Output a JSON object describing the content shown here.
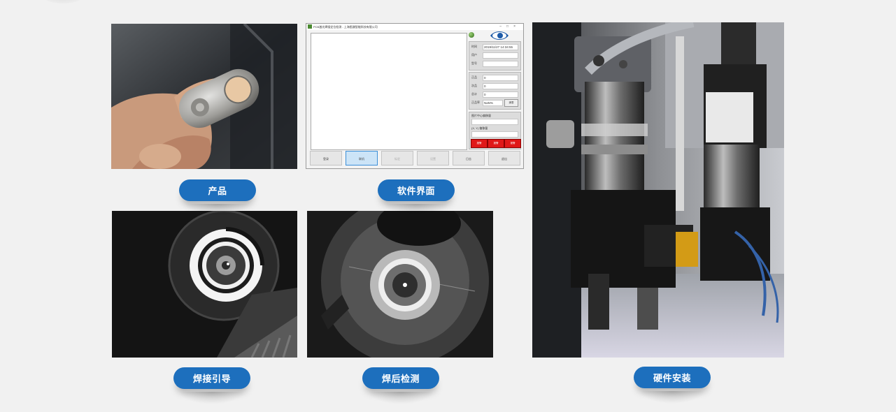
{
  "labels": {
    "product": "产品",
    "software": "软件界面",
    "weld_guide": "焊接引导",
    "post_weld_inspect": "焊后检测",
    "hardware": "硬件安装"
  },
  "software_window": {
    "title": "PCB激光焊接定位检测 - 上海图漾智能科技有限公司",
    "datetime_label": "时间",
    "datetime_value": "2019/11/27   14:34:55",
    "user_label": "用户",
    "model_label": "型号",
    "ok_label": "正品",
    "ok_value": "0",
    "ng_label": "次品",
    "ng_value": "0",
    "total_label": "总计",
    "total_value": "0",
    "rate_label": "正品率",
    "rate_value": "NaN%",
    "clear_button": "清零",
    "offset_label": "图片中心偏移量",
    "xy_label": "(X, Y) 偏移量",
    "red_buttons": [
      "报警",
      "报警",
      "报警"
    ],
    "bottom_buttons": [
      "登录",
      "联机",
      "标定",
      "设置",
      "日志",
      "退出"
    ]
  },
  "colors": {
    "pill_blue": "#1d6fbd",
    "background": "#f1f1f1",
    "alarm_red": "#e01818"
  }
}
